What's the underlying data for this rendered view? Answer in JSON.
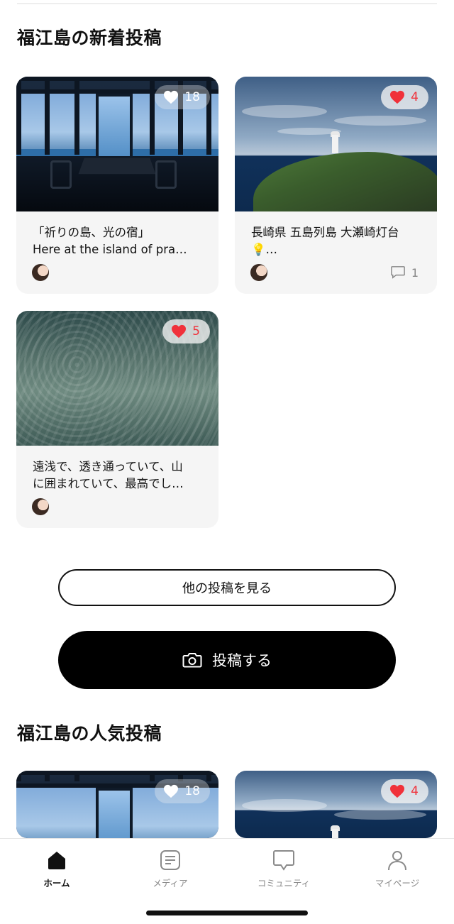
{
  "sections": {
    "new_posts_title": "福江島の新着投稿",
    "popular_posts_title": "福江島の人気投稿"
  },
  "new_posts": [
    {
      "likes": "18",
      "liked": false,
      "caption_line1": "「祈りの島、光の宿」",
      "caption_line2": "Here at the island of pra…",
      "comments": ""
    },
    {
      "likes": "4",
      "liked": true,
      "caption_line1": "長崎県 五島列島 大瀬崎灯台",
      "caption_line2": "💡…",
      "comments": "1"
    },
    {
      "likes": "5",
      "liked": true,
      "caption_line1": "遠浅で、透き通っていて、山",
      "caption_line2": "に囲まれていて、最高でし…",
      "comments": ""
    }
  ],
  "popular_posts": [
    {
      "likes": "18",
      "liked": false
    },
    {
      "likes": "4",
      "liked": true
    }
  ],
  "buttons": {
    "more_posts": "他の投稿を見る",
    "post": "投稿する"
  },
  "tabbar": {
    "items": [
      {
        "label": "ホーム",
        "icon": "home-icon",
        "active": true
      },
      {
        "label": "メディア",
        "icon": "media-icon",
        "active": false
      },
      {
        "label": "コミュニティ",
        "icon": "chat-bubble-icon",
        "active": false
      },
      {
        "label": "マイページ",
        "icon": "person-icon",
        "active": false
      }
    ]
  },
  "colors": {
    "like_red": "#f0313a",
    "card_bg": "#f5f5f5",
    "primary_black": "#000000"
  }
}
